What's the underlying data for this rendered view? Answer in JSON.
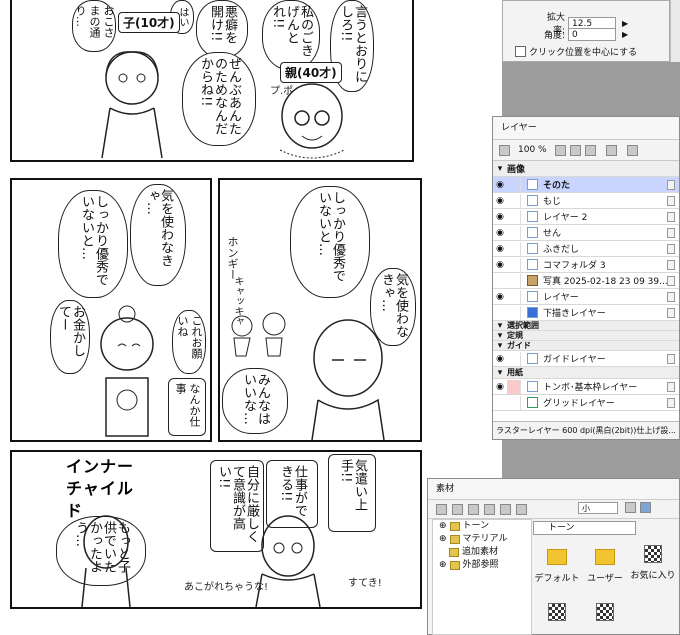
{
  "zoom_panel": {
    "scale_label": "拡大率:",
    "scale_value": "12.5",
    "angle_label": "角度:",
    "angle_value": "0",
    "center_label": "クリック位置を中心にする"
  },
  "layer_panel": {
    "title": "レイヤー",
    "opacity": "100 %",
    "layers": [
      {
        "name": "画像",
        "kind": "group"
      },
      {
        "name": "そのた",
        "kind": "layer",
        "selected": true
      },
      {
        "name": "もじ",
        "kind": "layer"
      },
      {
        "name": "レイヤー 2",
        "kind": "layer"
      },
      {
        "name": "せん",
        "kind": "layer"
      },
      {
        "name": "ふきだし",
        "kind": "layer"
      },
      {
        "name": "コマフォルダ 3",
        "kind": "layer"
      },
      {
        "name": "写真 2025-02-18 23 09 39...",
        "kind": "layer"
      },
      {
        "name": "レイヤー",
        "kind": "layer"
      },
      {
        "name": "下描きレイヤー",
        "kind": "layer"
      },
      {
        "name": "選択範囲",
        "kind": "group"
      },
      {
        "name": "定規",
        "kind": "group"
      },
      {
        "name": "ガイド",
        "kind": "group"
      },
      {
        "name": "ガイドレイヤー",
        "kind": "layer"
      },
      {
        "name": "用紙",
        "kind": "group"
      },
      {
        "name": "トンボ･基本枠レイヤー",
        "kind": "layer"
      },
      {
        "name": "グリッドレイヤー",
        "kind": "layer"
      }
    ],
    "status": "ラスターレイヤー 600 dpi(黒白(2bit))仕上げ設..."
  },
  "material_panel": {
    "title": "素材",
    "size_select": "小",
    "tree": [
      "トーン",
      "マテリアル",
      "追加素材",
      "外部参照"
    ],
    "combo": "トーン",
    "tiles": [
      "デフォルト",
      "ユーザー",
      "お気に入り"
    ]
  },
  "manga": {
    "p1": [
      "言うとおりにしろ!!",
      "私のごきげんとれ!!",
      "悪癖を開け!!",
      "はい",
      "おこさまの通り…",
      "ぜんぶあんたのためなんだからね!!"
    ],
    "p1_tags": [
      "子(10才)",
      "親(40才)"
    ],
    "p1_sfx": "プ.ポ",
    "p2": [
      "気を使わなきゃ…",
      "しっかり優秀でいないと…",
      "お金かしてー",
      "これお願いね",
      "なんか仕事"
    ],
    "p3": [
      "しっかり優秀でいないと…",
      "気を使わなきゃ…",
      "みんなはいいな…"
    ],
    "p3_sfx": [
      "ホンギー",
      "キャッキャ"
    ],
    "p4_title": "インナーチャイルド",
    "p4": [
      "もっと子供でいたかったよう…",
      "気遣い上手!!",
      "仕事ができる!!",
      "自分に厳しくて意識が高い!!"
    ],
    "p4_sfx": [
      "あこがれちゃうな!",
      "すてき!"
    ]
  }
}
